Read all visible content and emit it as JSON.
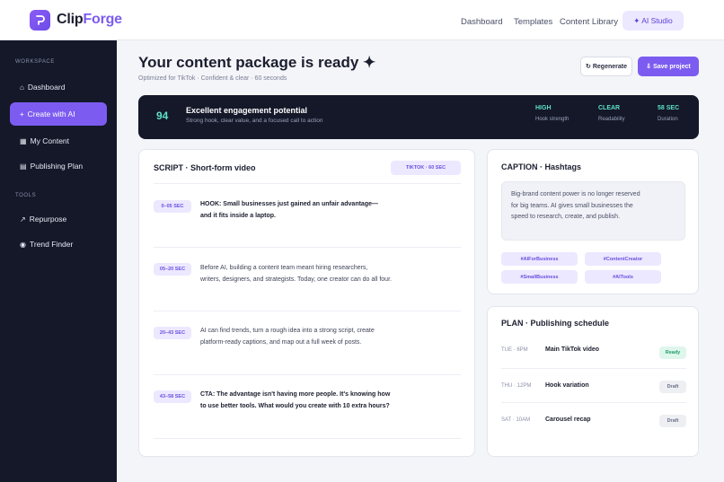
{
  "brand": {
    "name_part1": "Clip",
    "name_part2": "Forge"
  },
  "topnav": {
    "links": [
      "Dashboard",
      "Templates",
      "Content Library"
    ],
    "ai_button": "✦ AI Studio"
  },
  "sidebar": {
    "workspace_heading": "WORKSPACE",
    "tools_heading": "TOOLS",
    "items": [
      {
        "icon": "⌂",
        "label": "Dashboard"
      },
      {
        "icon": "+",
        "label": "Create with AI"
      },
      {
        "icon": "▦",
        "label": "My Content"
      },
      {
        "icon": "▤",
        "label": "Publishing Plan"
      },
      {
        "icon": "↗",
        "label": "Repurpose"
      },
      {
        "icon": "◉",
        "label": "Trend Finder"
      }
    ]
  },
  "header": {
    "title": "Your content package is ready ✦",
    "subtitle": "Optimized for TikTok · Confident & clear · 60 seconds",
    "regenerate_label": "↻ Regenerate",
    "save_label": "⇩ Save project"
  },
  "score": {
    "value": "94",
    "title": "Excellent engagement potential",
    "subtitle": "Strong hook, clear value, and a focused call to action",
    "metrics": [
      {
        "value": "HIGH",
        "label": "Hook strength"
      },
      {
        "value": "CLEAR",
        "label": "Readability"
      },
      {
        "value": "58 SEC",
        "label": "Duration"
      }
    ]
  },
  "script": {
    "title": "SCRIPT · Short-form video",
    "badge": "TIKTOK · 60 SEC",
    "segments": [
      {
        "time": "0–05 SEC",
        "line1": "HOOK: Small businesses just gained an unfair advantage—",
        "line2": "and it fits inside a laptop."
      },
      {
        "time": "05–20 SEC",
        "line1": "Before AI, building a content team meant hiring researchers,",
        "line2": "writers, designers, and strategists. Today, one creator can do all four."
      },
      {
        "time": "20–43 SEC",
        "line1": "AI can find trends, turn a rough idea into a strong script, create",
        "line2": "platform-ready captions, and map out a full week of posts."
      },
      {
        "time": "43–58 SEC",
        "line1": "CTA: The advantage isn't having more people. It's knowing how",
        "line2": "to use better tools. What would you create with 10 extra hours?"
      }
    ]
  },
  "caption": {
    "title": "CAPTION · Hashtags",
    "lines": [
      "Big-brand content power is no longer reserved",
      "for big teams. AI gives small businesses the",
      "speed to research, create, and publish."
    ],
    "hashtags": [
      "#AIForBusiness",
      "#ContentCreator",
      "#SmallBusiness",
      "#AITools"
    ]
  },
  "plan": {
    "title": "PLAN · Publishing schedule",
    "rows": [
      {
        "time": "TUE · 6PM",
        "name": "Main TikTok video",
        "status": "Ready"
      },
      {
        "time": "THU · 12PM",
        "name": "Hook variation",
        "status": "Draft"
      },
      {
        "time": "SAT · 10AM",
        "name": "Carousel recap",
        "status": "Draft"
      }
    ]
  },
  "colors": {
    "accent": "#7c5cf0",
    "sidebar": "#141829",
    "score": "#5ee0c8"
  }
}
